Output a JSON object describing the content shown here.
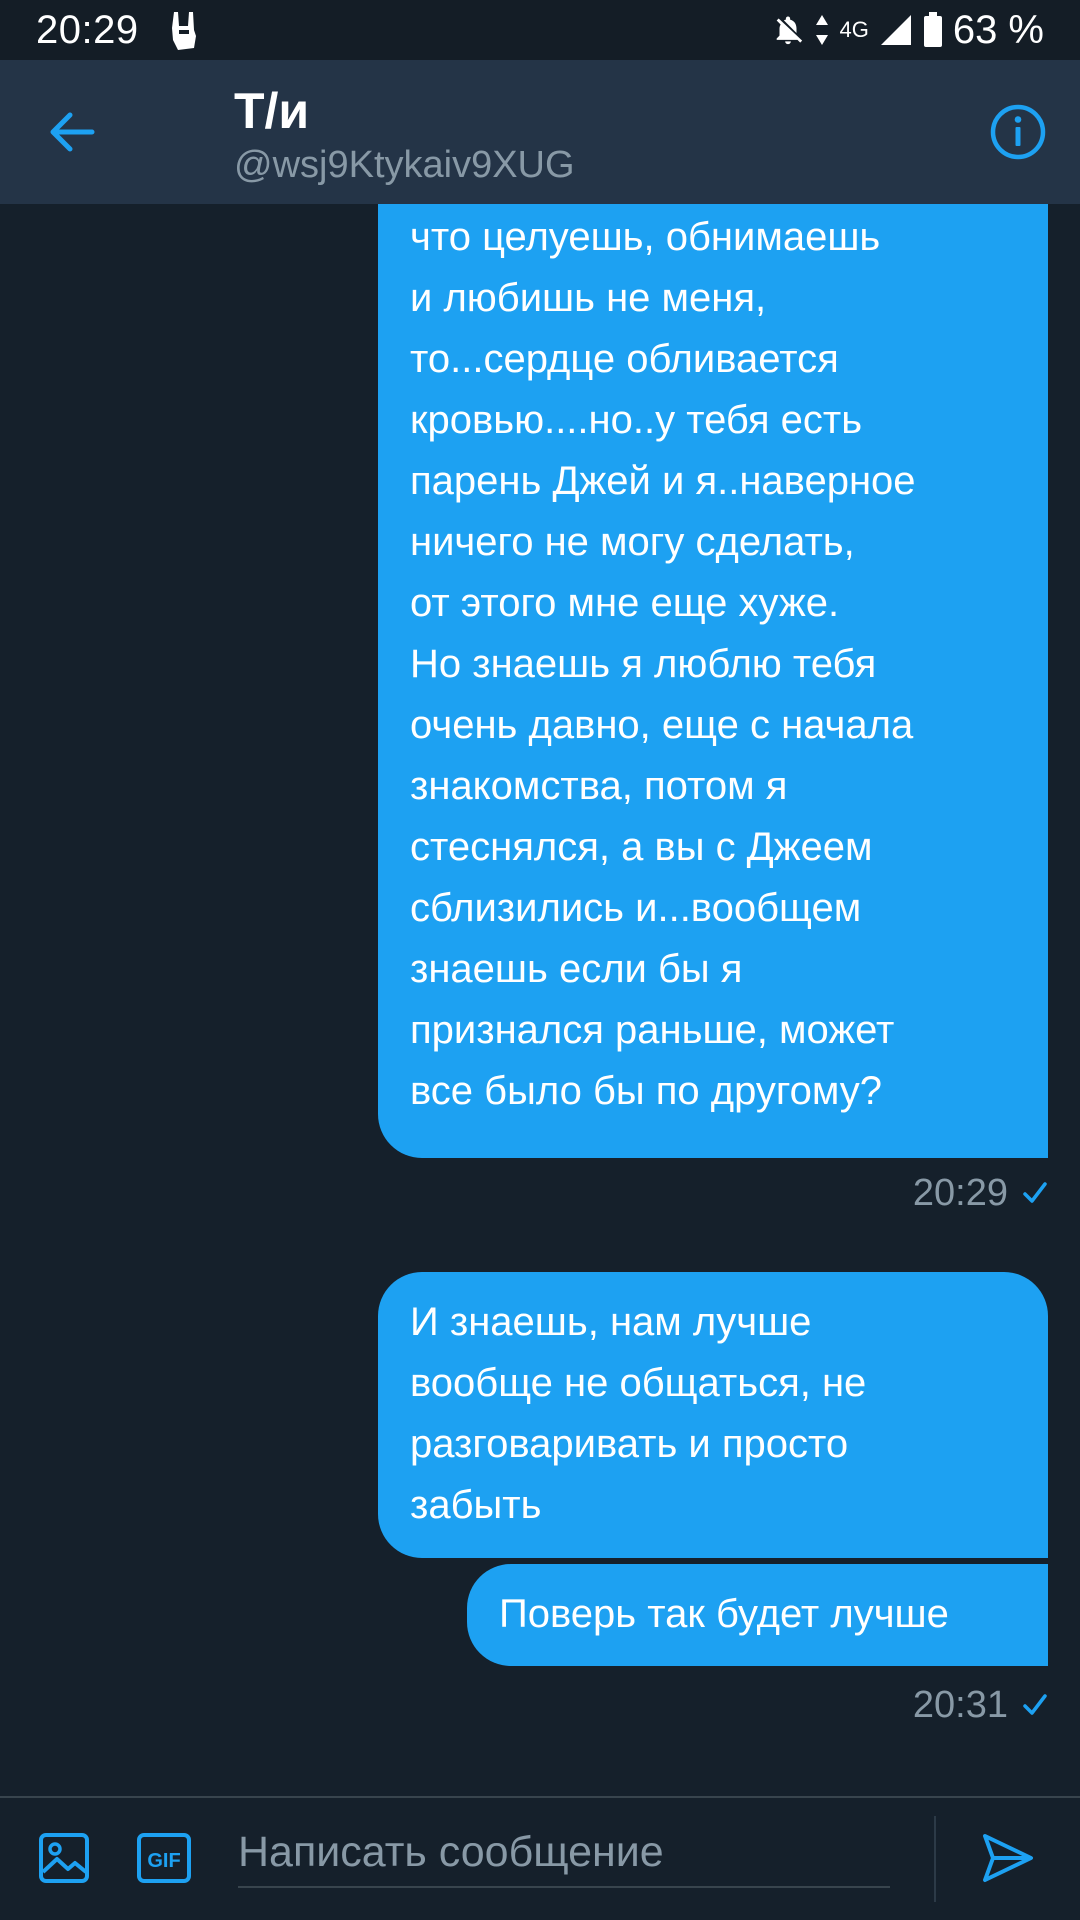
{
  "status_bar": {
    "time": "20:29",
    "network": "4G",
    "battery": "63 %",
    "icons": [
      "rock-hand-icon",
      "bell-off-icon",
      "data-arrows-icon",
      "signal-icon",
      "battery-icon"
    ]
  },
  "header": {
    "title": "Т/и",
    "handle": "@wsj9Ktykaiv9XUG",
    "icons": [
      "back-arrow-icon",
      "info-icon"
    ]
  },
  "messages": [
    {
      "direction": "outgoing",
      "text": "мной. А если представлю,\nчто целуешь, обнимаешь\nи любишь не меня,\nто...сердце обливается\nкровью....но..у тебя есть\nпарень Джей и я..наверное\nничего не могу сделать,\nот этого мне еще хуже.\nНо знаешь я люблю тебя\nочень давно, еще с начала\nзнакомства, потом я\nстеснялся, а вы с Джеем\nсблизились и...вообщем\nзнаешь если бы я\nпризнался раньше, может\nвсе было бы по другому?"
    },
    {
      "direction": "outgoing",
      "text": "И знаешь, нам лучше\nвообще не общаться, не\nразговаривать и просто\nзабыть"
    },
    {
      "direction": "outgoing",
      "text": "Поверь так будет лучше"
    }
  ],
  "timestamps": [
    "20:29",
    "20:31"
  ],
  "composer": {
    "placeholder": "Написать сообщение",
    "value": "",
    "icons": [
      "image-icon",
      "gif-icon",
      "send-icon"
    ],
    "gif_label": "GIF"
  },
  "colors": {
    "background": "#15202b",
    "header": "#243447",
    "accent": "#1da1f2",
    "secondary_text": "#8899a6"
  }
}
